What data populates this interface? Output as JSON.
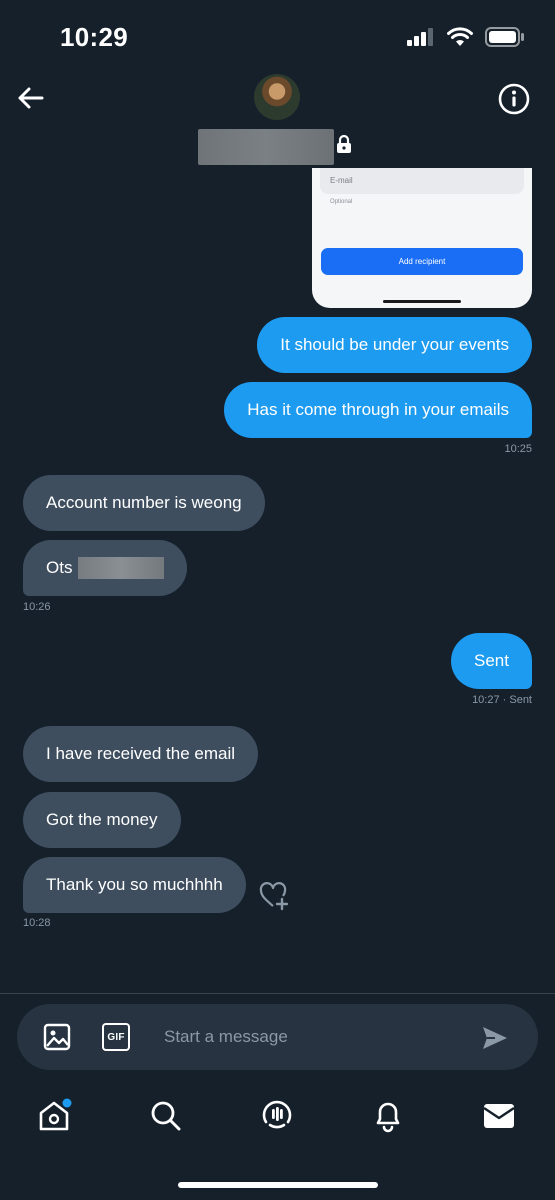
{
  "status_bar": {
    "time": "10:29"
  },
  "conversation": {
    "attachment_card": {
      "field_label": "E-mail",
      "optional_text": "Optional",
      "button_label": "Add recipient"
    },
    "messages": [
      {
        "side": "sent",
        "text": "It should be under your events"
      },
      {
        "side": "sent",
        "text": "Has it come through in your emails"
      },
      {
        "side": "time",
        "text": "10:25"
      },
      {
        "side": "received",
        "text": "Account number is weong"
      },
      {
        "side": "received",
        "text": "Ots"
      },
      {
        "side": "time",
        "text": "10:26"
      },
      {
        "side": "sent",
        "text": "Sent"
      },
      {
        "side": "time",
        "text": "10:27 · Sent"
      },
      {
        "side": "received",
        "text": "I have received the email"
      },
      {
        "side": "received",
        "text": "Got the money"
      },
      {
        "side": "received",
        "text": "Thank you so muchhhh"
      },
      {
        "side": "time",
        "text": "10:28"
      }
    ]
  },
  "composer": {
    "placeholder": "Start a message",
    "gif_label": "GIF"
  },
  "icons": [
    "back-arrow-icon",
    "info-icon",
    "lock-icon",
    "add-reaction-icon",
    "image-icon",
    "gif-icon",
    "send-icon",
    "home-icon",
    "search-icon",
    "spaces-icon",
    "notifications-icon",
    "messages-icon"
  ],
  "colors": {
    "background": "#15202b",
    "sent_bubble": "#1d9bf0",
    "received_bubble": "#3e4e5f",
    "composer": "#273340",
    "muted_text": "#8b98a5"
  }
}
